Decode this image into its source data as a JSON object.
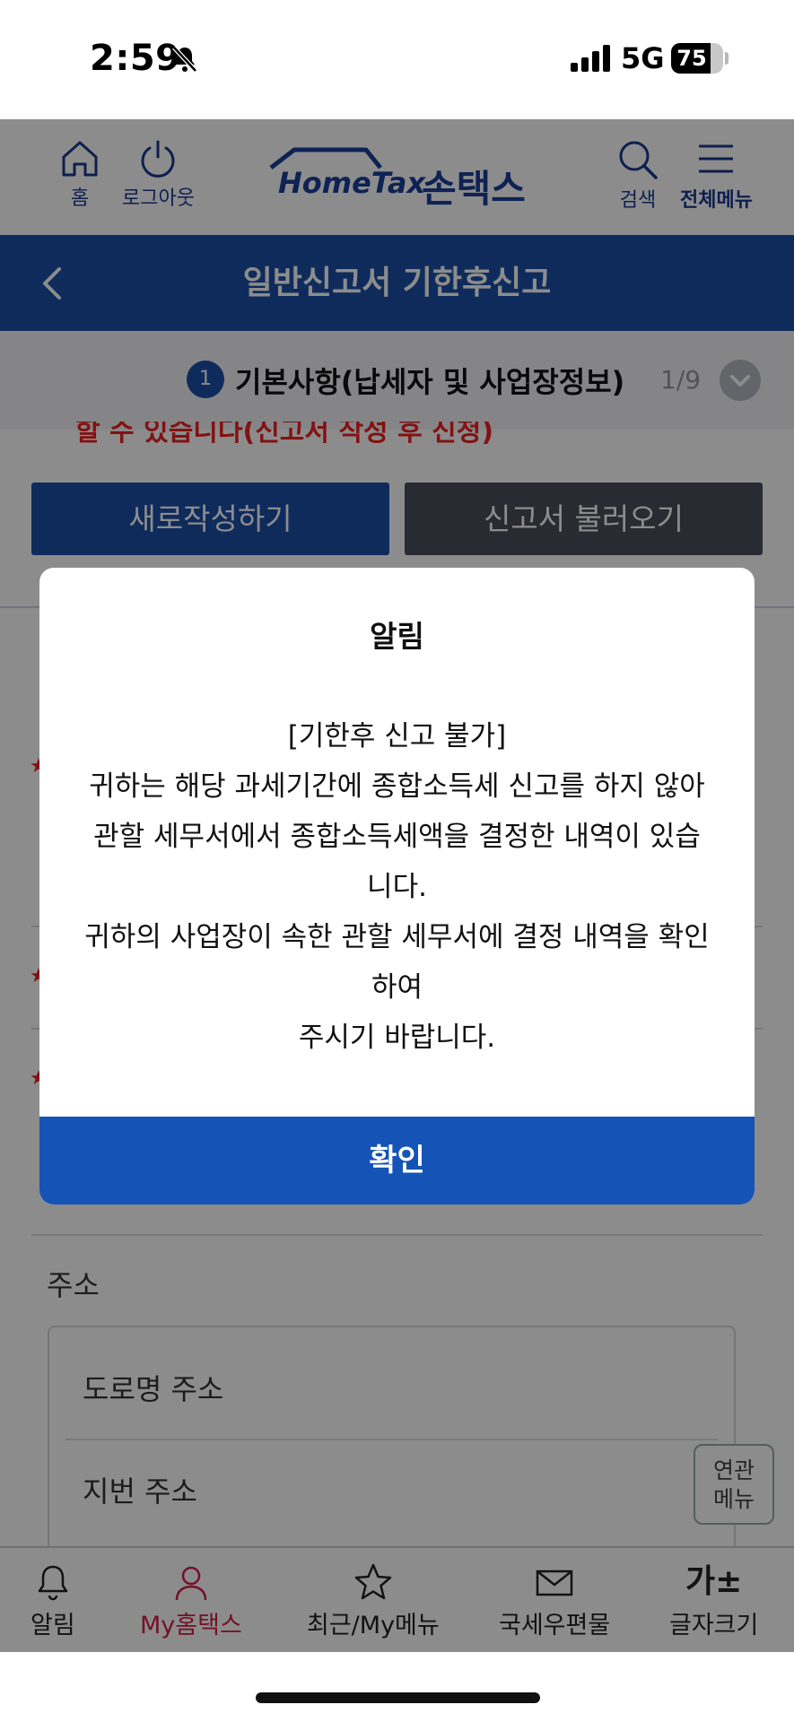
{
  "status_bar": {
    "time": "2:59",
    "network": "5G",
    "battery": "75",
    "battery_level": 0.75
  },
  "header": {
    "home_label": "홈",
    "logout_label": "로그아웃",
    "logo_en": "HomeTax",
    "logo_ko": "손택스",
    "search_label": "검색",
    "menu_label": "전체메뉴"
  },
  "title_bar": {
    "title": "일반신고서 기한후신고"
  },
  "step": {
    "number": "1",
    "title": "기본사항(납세자 및 사업장정보)",
    "count": "1/9"
  },
  "background": {
    "warning": "할 수 있습니다(신고서 작성 후 신청)",
    "new_button": "새로작성하기",
    "load_button": "신고서 불러오기",
    "address_label": "주소",
    "road_address": "도로명 주소",
    "lot_address": "지번 주소",
    "related_menu": [
      "연관",
      "메뉴"
    ]
  },
  "bottom_nav": {
    "items": [
      {
        "label": "알림",
        "icon": "bell-icon"
      },
      {
        "label": "My홈택스",
        "icon": "person-icon"
      },
      {
        "label": "최근/My메뉴",
        "icon": "star-icon"
      },
      {
        "label": "국세우편물",
        "icon": "mail-icon"
      },
      {
        "label": "글자크기",
        "icon": "font-size-icon",
        "glyph": "가±"
      }
    ]
  },
  "modal": {
    "title": "알림",
    "lines": [
      "[기한후 신고 불가]",
      "귀하는 해당 과세기간에 종합소득세 신고를 하지 않아",
      "관할 세무서에서 종합소득세액을 결정한 내역이 있습",
      "니다.",
      "귀하의 사업장이 속한 관할 세무서에 결정 내역을 확인",
      "하여",
      "주시기 바랍니다."
    ],
    "confirm_label": "확인"
  },
  "colors": {
    "primary": "#1a4fa8",
    "modal_button": "#1553b6",
    "active_nav": "#d11f4a",
    "warning": "#e22222"
  }
}
